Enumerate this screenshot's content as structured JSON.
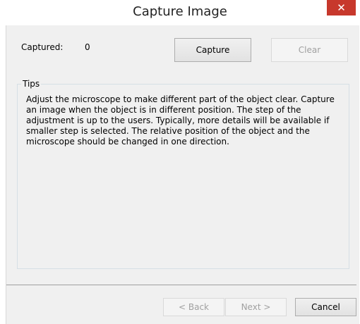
{
  "window": {
    "title": "Capture Image",
    "close_glyph": "✕"
  },
  "capture": {
    "captured_label": "Captured:",
    "captured_value": "0",
    "capture_button": "Capture",
    "clear_button": "Clear"
  },
  "tips": {
    "legend": "Tips",
    "text": "Adjust the microscope to make different part of the object clear. Capture an image when the object is in different position. The step of the adjustment is up to the users. Typically, more details will be available if smaller step is selected. The relative position of the object and the microscope should be changed in one direction."
  },
  "footer": {
    "back_button": "< Back",
    "next_button": "Next >",
    "cancel_button": "Cancel"
  },
  "colors": {
    "close_button_bg": "#c7382c",
    "dialog_bg": "#f0f0f0",
    "disabled_text": "#a0a0a0"
  }
}
